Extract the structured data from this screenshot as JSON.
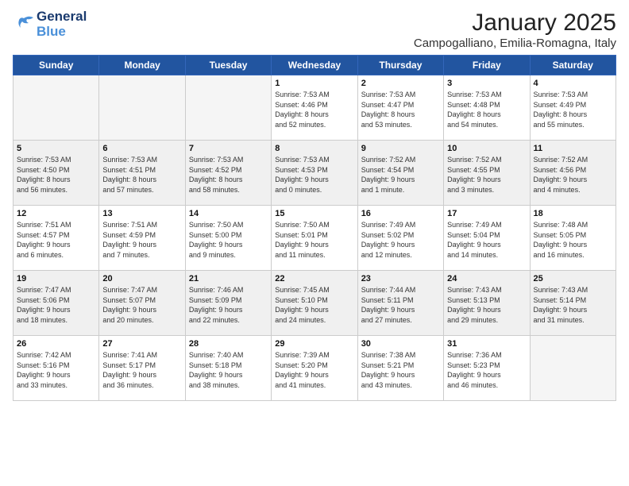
{
  "logo": {
    "part1": "General",
    "part2": "Blue"
  },
  "title": "January 2025",
  "subtitle": "Campogalliano, Emilia-Romagna, Italy",
  "weekdays": [
    "Sunday",
    "Monday",
    "Tuesday",
    "Wednesday",
    "Thursday",
    "Friday",
    "Saturday"
  ],
  "weeks": [
    [
      {
        "day": "",
        "info": ""
      },
      {
        "day": "",
        "info": ""
      },
      {
        "day": "",
        "info": ""
      },
      {
        "day": "1",
        "info": "Sunrise: 7:53 AM\nSunset: 4:46 PM\nDaylight: 8 hours\nand 52 minutes."
      },
      {
        "day": "2",
        "info": "Sunrise: 7:53 AM\nSunset: 4:47 PM\nDaylight: 8 hours\nand 53 minutes."
      },
      {
        "day": "3",
        "info": "Sunrise: 7:53 AM\nSunset: 4:48 PM\nDaylight: 8 hours\nand 54 minutes."
      },
      {
        "day": "4",
        "info": "Sunrise: 7:53 AM\nSunset: 4:49 PM\nDaylight: 8 hours\nand 55 minutes."
      }
    ],
    [
      {
        "day": "5",
        "info": "Sunrise: 7:53 AM\nSunset: 4:50 PM\nDaylight: 8 hours\nand 56 minutes."
      },
      {
        "day": "6",
        "info": "Sunrise: 7:53 AM\nSunset: 4:51 PM\nDaylight: 8 hours\nand 57 minutes."
      },
      {
        "day": "7",
        "info": "Sunrise: 7:53 AM\nSunset: 4:52 PM\nDaylight: 8 hours\nand 58 minutes."
      },
      {
        "day": "8",
        "info": "Sunrise: 7:53 AM\nSunset: 4:53 PM\nDaylight: 9 hours\nand 0 minutes."
      },
      {
        "day": "9",
        "info": "Sunrise: 7:52 AM\nSunset: 4:54 PM\nDaylight: 9 hours\nand 1 minute."
      },
      {
        "day": "10",
        "info": "Sunrise: 7:52 AM\nSunset: 4:55 PM\nDaylight: 9 hours\nand 3 minutes."
      },
      {
        "day": "11",
        "info": "Sunrise: 7:52 AM\nSunset: 4:56 PM\nDaylight: 9 hours\nand 4 minutes."
      }
    ],
    [
      {
        "day": "12",
        "info": "Sunrise: 7:51 AM\nSunset: 4:57 PM\nDaylight: 9 hours\nand 6 minutes."
      },
      {
        "day": "13",
        "info": "Sunrise: 7:51 AM\nSunset: 4:59 PM\nDaylight: 9 hours\nand 7 minutes."
      },
      {
        "day": "14",
        "info": "Sunrise: 7:50 AM\nSunset: 5:00 PM\nDaylight: 9 hours\nand 9 minutes."
      },
      {
        "day": "15",
        "info": "Sunrise: 7:50 AM\nSunset: 5:01 PM\nDaylight: 9 hours\nand 11 minutes."
      },
      {
        "day": "16",
        "info": "Sunrise: 7:49 AM\nSunset: 5:02 PM\nDaylight: 9 hours\nand 12 minutes."
      },
      {
        "day": "17",
        "info": "Sunrise: 7:49 AM\nSunset: 5:04 PM\nDaylight: 9 hours\nand 14 minutes."
      },
      {
        "day": "18",
        "info": "Sunrise: 7:48 AM\nSunset: 5:05 PM\nDaylight: 9 hours\nand 16 minutes."
      }
    ],
    [
      {
        "day": "19",
        "info": "Sunrise: 7:47 AM\nSunset: 5:06 PM\nDaylight: 9 hours\nand 18 minutes."
      },
      {
        "day": "20",
        "info": "Sunrise: 7:47 AM\nSunset: 5:07 PM\nDaylight: 9 hours\nand 20 minutes."
      },
      {
        "day": "21",
        "info": "Sunrise: 7:46 AM\nSunset: 5:09 PM\nDaylight: 9 hours\nand 22 minutes."
      },
      {
        "day": "22",
        "info": "Sunrise: 7:45 AM\nSunset: 5:10 PM\nDaylight: 9 hours\nand 24 minutes."
      },
      {
        "day": "23",
        "info": "Sunrise: 7:44 AM\nSunset: 5:11 PM\nDaylight: 9 hours\nand 27 minutes."
      },
      {
        "day": "24",
        "info": "Sunrise: 7:43 AM\nSunset: 5:13 PM\nDaylight: 9 hours\nand 29 minutes."
      },
      {
        "day": "25",
        "info": "Sunrise: 7:43 AM\nSunset: 5:14 PM\nDaylight: 9 hours\nand 31 minutes."
      }
    ],
    [
      {
        "day": "26",
        "info": "Sunrise: 7:42 AM\nSunset: 5:16 PM\nDaylight: 9 hours\nand 33 minutes."
      },
      {
        "day": "27",
        "info": "Sunrise: 7:41 AM\nSunset: 5:17 PM\nDaylight: 9 hours\nand 36 minutes."
      },
      {
        "day": "28",
        "info": "Sunrise: 7:40 AM\nSunset: 5:18 PM\nDaylight: 9 hours\nand 38 minutes."
      },
      {
        "day": "29",
        "info": "Sunrise: 7:39 AM\nSunset: 5:20 PM\nDaylight: 9 hours\nand 41 minutes."
      },
      {
        "day": "30",
        "info": "Sunrise: 7:38 AM\nSunset: 5:21 PM\nDaylight: 9 hours\nand 43 minutes."
      },
      {
        "day": "31",
        "info": "Sunrise: 7:36 AM\nSunset: 5:23 PM\nDaylight: 9 hours\nand 46 minutes."
      },
      {
        "day": "",
        "info": ""
      }
    ]
  ]
}
